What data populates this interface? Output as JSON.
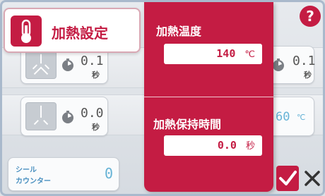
{
  "dialog": {
    "title": "加熱設定",
    "title_icon": "thermometer-icon",
    "heating_temperature": {
      "label": "加熱温度",
      "value": "140",
      "unit": "℃"
    },
    "heating_hold_time": {
      "label": "加熱保持時間",
      "value": "0.0",
      "unit": "秒"
    },
    "accent_color": "#c41c43"
  },
  "help_button": {
    "label": "?"
  },
  "confirm_button": {
    "icon": "check-icon"
  },
  "cancel_button": {
    "icon": "close-icon"
  },
  "background": {
    "left_timer_1": {
      "value": "0.1",
      "unit": "秒"
    },
    "right_timer_1": {
      "value": "0.1",
      "unit": "秒"
    },
    "left_timer_2": {
      "value": "0.0",
      "unit": "秒"
    },
    "right_temp": {
      "value": "60",
      "unit": "℃"
    },
    "seal_counter": {
      "label_line1": "シール",
      "label_line2": "カウンター",
      "value": "0"
    }
  }
}
